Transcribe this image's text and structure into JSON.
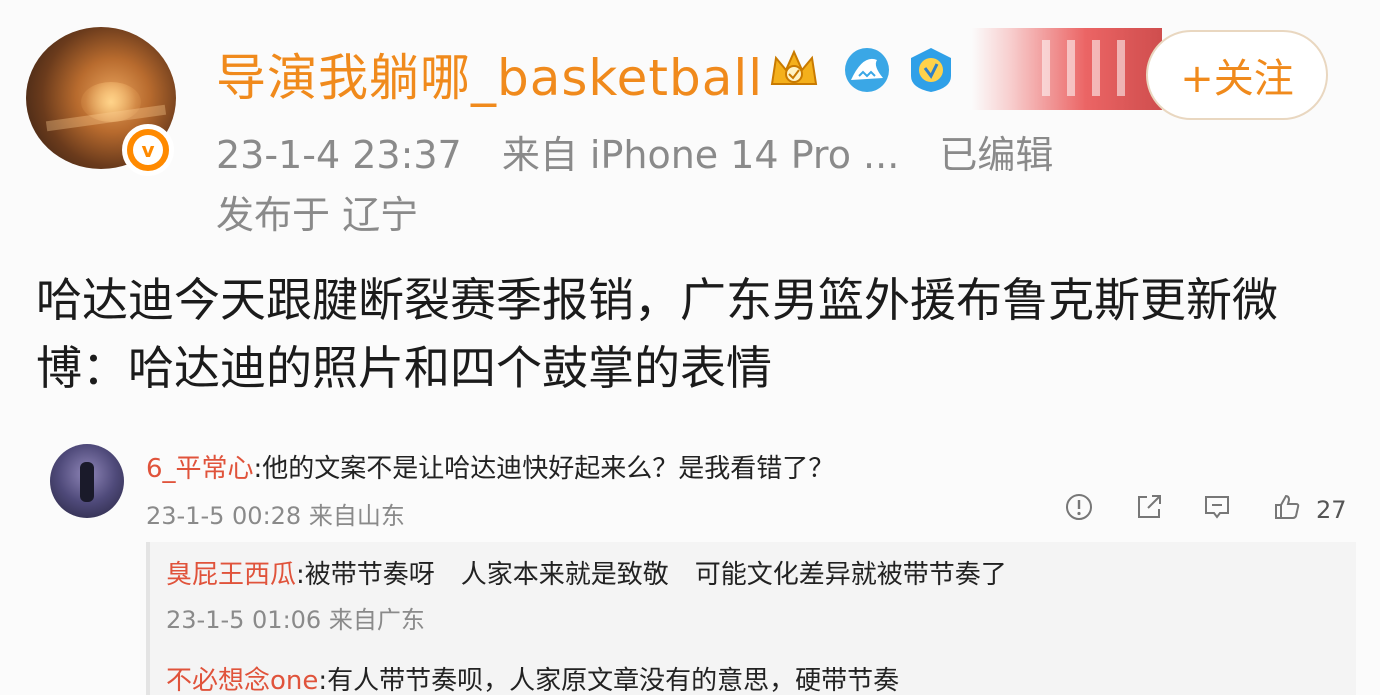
{
  "post": {
    "username": "导演我躺哪_basketball",
    "follow_label": "+关注",
    "timestamp": "23-1-4 23:37",
    "source": "来自 iPhone 14 Pro ...",
    "edited": "已编辑",
    "location": "发布于 辽宁",
    "content": "哈达迪今天跟腱断裂赛季报销，广东男篮外援布鲁克斯更新微博：哈达迪的照片和四个鼓掌的表情"
  },
  "comments": [
    {
      "author": "6_平常心",
      "text": ":他的文案不是让哈达迪快好起来么？是我看错了？",
      "meta": "23-1-5 00:28 来自山东",
      "likes": "27"
    }
  ],
  "replies": [
    {
      "author": "臭屁王西瓜",
      "text": ":被带节奏呀　人家本来就是致敬　可能文化差异就被带节奏了",
      "meta": "23-1-5 01:06 来自广东"
    },
    {
      "author": "不必想念one",
      "text": ":有人带节奏呗，人家原文章没有的意思，硬带节奏"
    }
  ],
  "icons": {
    "avatar": "user-avatar",
    "verified": "verified-badge-icon",
    "crown": "crown-icon",
    "shark": "shark-icon",
    "vip": "vip-badge-icon",
    "report": "report-icon",
    "share": "share-icon",
    "comment": "comment-icon",
    "like": "like-icon"
  },
  "colors": {
    "username": "#f08a1c",
    "comment_name": "#e0533b",
    "meta": "#8a8a8a"
  }
}
